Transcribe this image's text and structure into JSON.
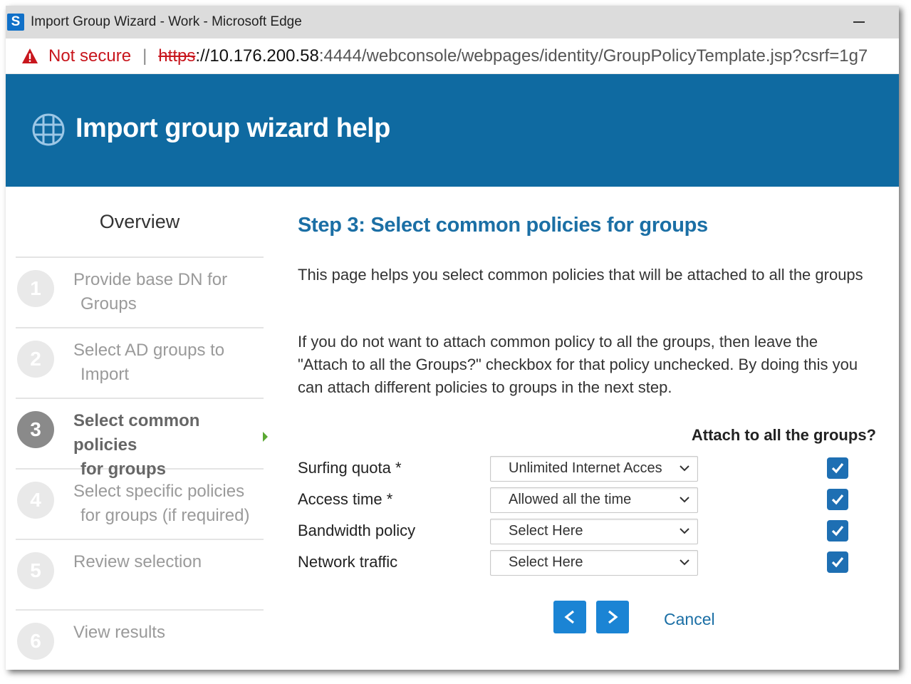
{
  "window": {
    "title": "Import Group Wizard - Work - Microsoft Edge",
    "app_icon_letter": "S"
  },
  "address_bar": {
    "security_label": "Not secure",
    "url_protocol": "https",
    "url_host": "://10.176.200.58",
    "url_rest": ":4444/webconsole/webpages/identity/GroupPolicyTemplate.jsp?csrf=1g7"
  },
  "header": {
    "title": "Import group wizard help",
    "icon": "globe-icon"
  },
  "sidebar": {
    "overview": "Overview",
    "steps": [
      {
        "num": "1",
        "line1": "Provide base DN for",
        "line2": "Groups"
      },
      {
        "num": "2",
        "line1": "Select AD groups to",
        "line2": "Import"
      },
      {
        "num": "3",
        "line1": "Select common policies",
        "line2": "for groups"
      },
      {
        "num": "4",
        "line1": "Select specific policies",
        "line2": "for groups (if required)"
      },
      {
        "num": "5",
        "line1": "Review selection",
        "line2": ""
      },
      {
        "num": "6",
        "line1": "View results",
        "line2": ""
      }
    ],
    "active_step": 3
  },
  "main": {
    "step_title": "Step 3: Select common policies for groups",
    "intro": "This page helps you select common policies that will be attached to all the groups",
    "instructions": "If you do not want to attach common policy to all the groups, then leave the \"Attach to all the Groups?\" checkbox for that policy unchecked. By doing this you can attach different policies to groups in the next step.",
    "attach_header": "Attach to all the groups?",
    "policies": [
      {
        "label": "Surfing quota *",
        "value": "Unlimited Internet Acces",
        "attach": true
      },
      {
        "label": "Access time *",
        "value": "Allowed all the time",
        "attach": true
      },
      {
        "label": "Bandwidth policy",
        "value": "Select Here",
        "attach": true
      },
      {
        "label": "Network traffic",
        "value": "Select Here",
        "attach": true
      }
    ],
    "back_label": "<",
    "next_label": ">",
    "cancel_label": "Cancel"
  },
  "colors": {
    "header_bg": "#0f6aa1",
    "accent": "#1b6fa5",
    "button": "#1b84d4",
    "checkbox": "#1e6fb3",
    "warning": "#c8161d"
  }
}
